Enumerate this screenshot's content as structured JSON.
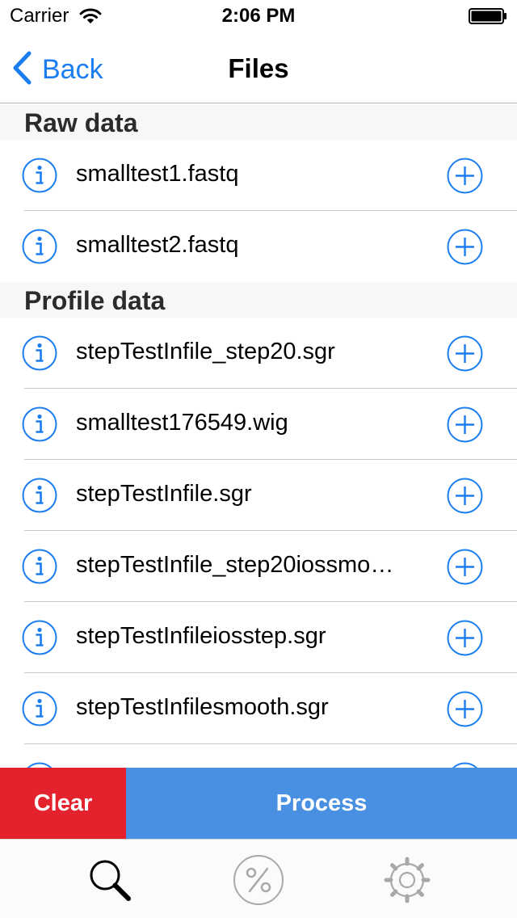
{
  "status_bar": {
    "carrier": "Carrier",
    "time": "2:06 PM"
  },
  "nav": {
    "back_label": "Back",
    "title": "Files"
  },
  "sections": [
    {
      "title": "Raw data",
      "files": [
        "smalltest1.fastq",
        "smalltest2.fastq"
      ]
    },
    {
      "title": "Profile data",
      "files": [
        "stepTestInfile_step20.sgr",
        "smalltest176549.wig",
        "stepTestInfile.sgr",
        "stepTestInfile_step20iossmo…",
        "stepTestInfileiosstep.sgr",
        "stepTestInfilesmooth.sgr",
        ""
      ]
    }
  ],
  "actions": {
    "clear_label": "Clear",
    "process_label": "Process"
  },
  "tabs": [
    {
      "icon": "search-icon",
      "selected": true
    },
    {
      "icon": "percent-icon",
      "selected": false
    },
    {
      "icon": "gear-icon",
      "selected": false
    }
  ],
  "colors": {
    "accent": "#1a7ef0",
    "clear": "#e3222d",
    "process": "#4a90e2",
    "tab_inactive": "#a8a8a8"
  }
}
